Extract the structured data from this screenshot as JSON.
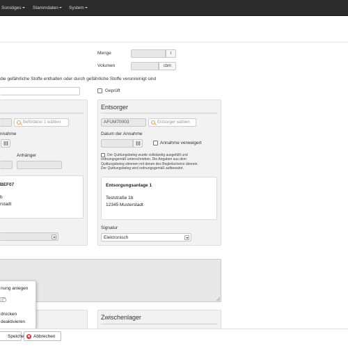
{
  "navbar": {
    "items": [
      {
        "label": "Sonstiges"
      },
      {
        "label": "Stammdaten"
      },
      {
        "label": "System"
      }
    ]
  },
  "form": {
    "menge_label": "Menge",
    "menge_unit": "t",
    "volumen_label": "Volumen",
    "volumen_unit": "cbm",
    "hazard_text": "die gefährliche Stoffe enthalten oder durch gefährliche Stoffe verunreinigt sind",
    "geprueft_label": "Geprüft"
  },
  "befoerderer": {
    "choose_button": "Beförderer 1 wählen",
    "annahme_label_partial": "nnahme",
    "anhaenger_label": "Anhänger",
    "address_id_partial": "BEF07",
    "address_line1_partial": "b",
    "address_line2_partial": "rstadt"
  },
  "entsorger": {
    "title": "Entsorger",
    "number_value": "AFUM70003",
    "choose_button": "Entsorger wählen",
    "datum_label": "Datum der Annahme",
    "verweigert_label": "Annahme verweigert",
    "notice_lines": [
      "Der Quittungsbeleg wurde vollständig ausgefüllt und",
      "ordnungsgemäß unterschrieben. Die Angaben aus dem",
      "Quittungsbeleg stimmen mit denen des Begleitscheins überein.",
      "Der Quittungsbeleg wird ordnungsgemäß aufbewahrt."
    ],
    "address_name": "Entsorgungsanlage 1",
    "address_street": "Teststraße 1b",
    "address_city": "12345 Musterstadt",
    "signatur_label": "Signatur",
    "signatur_value": "Elektronisch"
  },
  "zwischenlager": {
    "title": "Zwischenlager"
  },
  "popup": {
    "item1": "nung anlegen",
    "item2": "drucken",
    "item3": "deaktivieren"
  },
  "footer": {
    "save_label": "Speichern",
    "cancel_label": "Abbrechen"
  },
  "colors": {
    "navbar": "#2b2b2b",
    "panel": "#f2f2f2",
    "cancel_icon": "#d9333f",
    "search_icon": "#e0a43a"
  }
}
